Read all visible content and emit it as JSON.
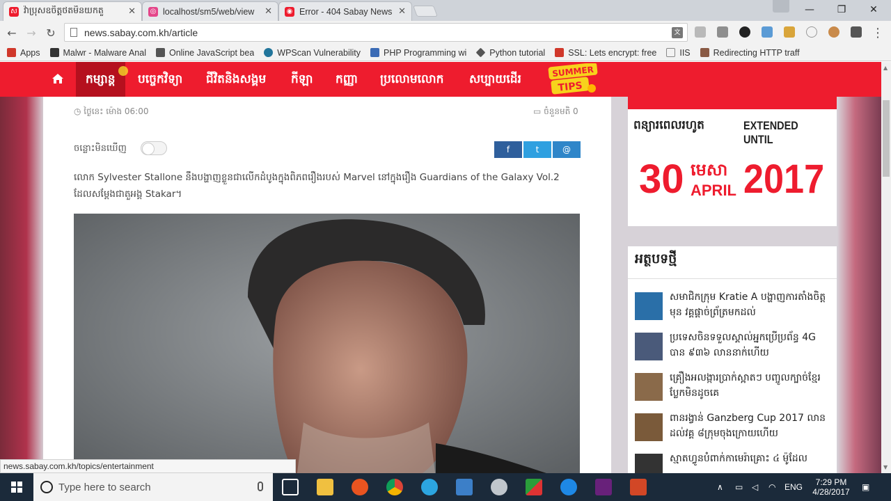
{
  "tabs": [
    {
      "title": "វ៉ាប្រុសឧចិត្តថតមិនយកតួ",
      "favicon_color": "#ee1c2e",
      "active": true
    },
    {
      "title": "localhost/sm5/web/view",
      "favicon_color": "#e4468a",
      "active": false
    },
    {
      "title": "Error - 404 Sabay News",
      "favicon_color": "#ee1c2e",
      "active": false
    }
  ],
  "address": {
    "url": "news.sabay.com.kh/article"
  },
  "bookmarks": [
    {
      "label": "Apps",
      "icon_color": "#d0382b"
    },
    {
      "label": "Malwr - Malware Anal",
      "icon_color": "#333333"
    },
    {
      "label": "Online JavaScript bea",
      "icon_color": "#555555"
    },
    {
      "label": "WPScan Vulnerability",
      "icon_color": "#21759b"
    },
    {
      "label": "PHP Programming wi",
      "icon_color": "#3b6bb5"
    },
    {
      "label": "Python tutorial",
      "icon_color": "#555555"
    },
    {
      "label": "SSL: Lets encrypt: free",
      "icon_color": "#d0382b"
    },
    {
      "label": "IIS",
      "icon_color": "#888888"
    },
    {
      "label": "Redirecting HTTP traff",
      "icon_color": "#8a5a44"
    }
  ],
  "site_nav": {
    "items": [
      "កម្សាន្ត",
      "បច្ចេកវិទ្យា",
      "ជីវិតនិងសង្គម",
      "កីឡា",
      "កញ្ញា",
      "ប្រលោមលោក",
      "សប្បាយដើរ"
    ],
    "summer_badge": [
      "SUMMER",
      "TIPS"
    ]
  },
  "article": {
    "date": "ថ្ងៃនេះ ម៉ោង 06:00",
    "comments": "ចំនួនមតិ 0",
    "toggle_label": "ចន្លោះមិនឃើញ",
    "share": [
      "f",
      "t",
      "@"
    ],
    "lede": "លោក Sylvester Stallone នឹងបង្ហាញខ្លួនជាលើកដំបូងក្នុងពិភពរឿងរបស់ Marvel នៅក្នុងរឿង Guardians of the Galaxy Vol.2 ដែលសម្ដែងជាតួអង្គ Stakar។"
  },
  "ad": {
    "left": "ពន្យារពេលរហូត",
    "right": "EXTENDED UNTIL",
    "day": "30",
    "month_km": "មេសា",
    "month_en": "APRIL",
    "year": "2017"
  },
  "latest": {
    "title": "អត្ថបទថ្មី",
    "items": [
      {
        "text": "សមាជិកក្រុម Kratie A បង្ហាញការតាំងចិត្តមុន វគ្គផ្ដាច់ព្រ័ត្រមកដល់",
        "thumb": "#2a6fa8"
      },
      {
        "text": "ប្រទេសចិនទទួលស្គាល់អ្នកប្រើប្រព័ន្ធ 4G បាន ៩៣៦ លាននាក់ហើយ",
        "thumb": "#4a5a7a"
      },
      {
        "text": "គ្រឿងអលង្ការប្រាក់ស្អាតៗ បញ្ចូលក្បាច់ខ្មែរប្លែកមិនដូចគេ",
        "thumb": "#8a6a4a"
      },
      {
        "text": "ពានរង្វាន់ Ganzberg Cup 2017 លានដល់វគ្គ ៨ក្រុមចុងក្រោយហើយ",
        "thumb": "#7a5a3a"
      },
      {
        "text": "ស្មាតហ្វូនបំពាក់កាមេរ៉ាគ្រោះ ៤ ម៉ូដែល",
        "thumb": "#333333"
      }
    ]
  },
  "status": {
    "url": "news.sabay.com.kh/topics/entertainment"
  },
  "taskbar": {
    "search_placeholder": "Type here to search",
    "lang": "ENG",
    "time": "7:29 PM",
    "date": "4/28/2017"
  }
}
